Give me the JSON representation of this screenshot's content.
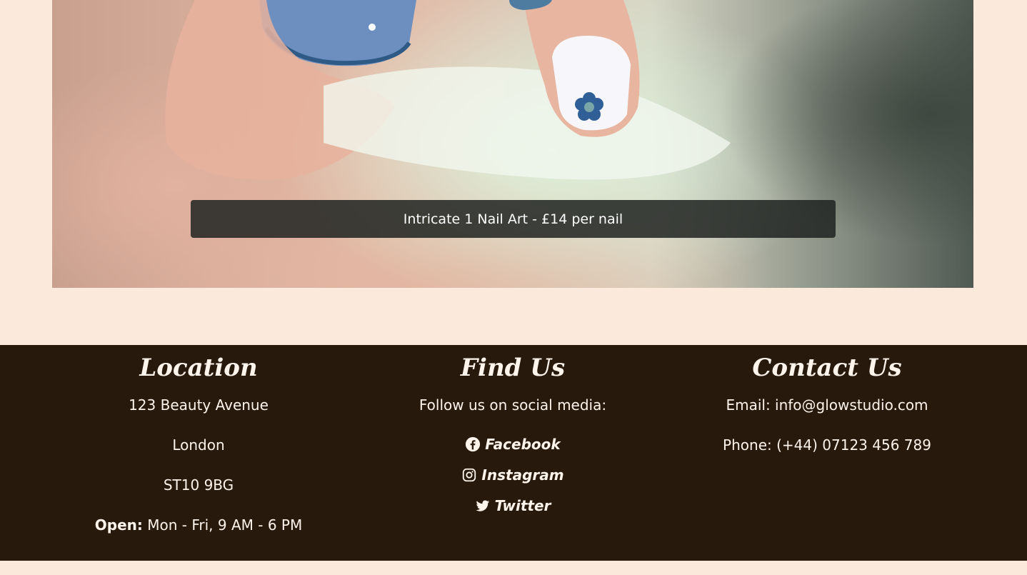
{
  "hero": {
    "caption": "Intricate 1 Nail Art - £14 per nail"
  },
  "footer": {
    "location": {
      "heading": "Location",
      "street": "123 Beauty Avenue",
      "city": "London",
      "postcode": "ST10 9BG",
      "open_label": "Open:",
      "open_hours": " Mon - Fri, 9 AM - 6 PM"
    },
    "find_us": {
      "heading": "Find Us",
      "intro": "Follow us on social media:",
      "links": [
        {
          "label": "Facebook",
          "icon": "facebook-icon"
        },
        {
          "label": "Instagram",
          "icon": "instagram-icon"
        },
        {
          "label": "Twitter",
          "icon": "twitter-icon"
        }
      ]
    },
    "contact": {
      "heading": "Contact Us",
      "email": "Email: info@glowstudio.com",
      "phone": "Phone: (+44) 07123 456 789"
    }
  },
  "colors": {
    "page_bg": "#fbe9dc",
    "footer_bg": "#28190d",
    "footer_text": "#fdf4ec",
    "caption_bg": "#212422"
  }
}
